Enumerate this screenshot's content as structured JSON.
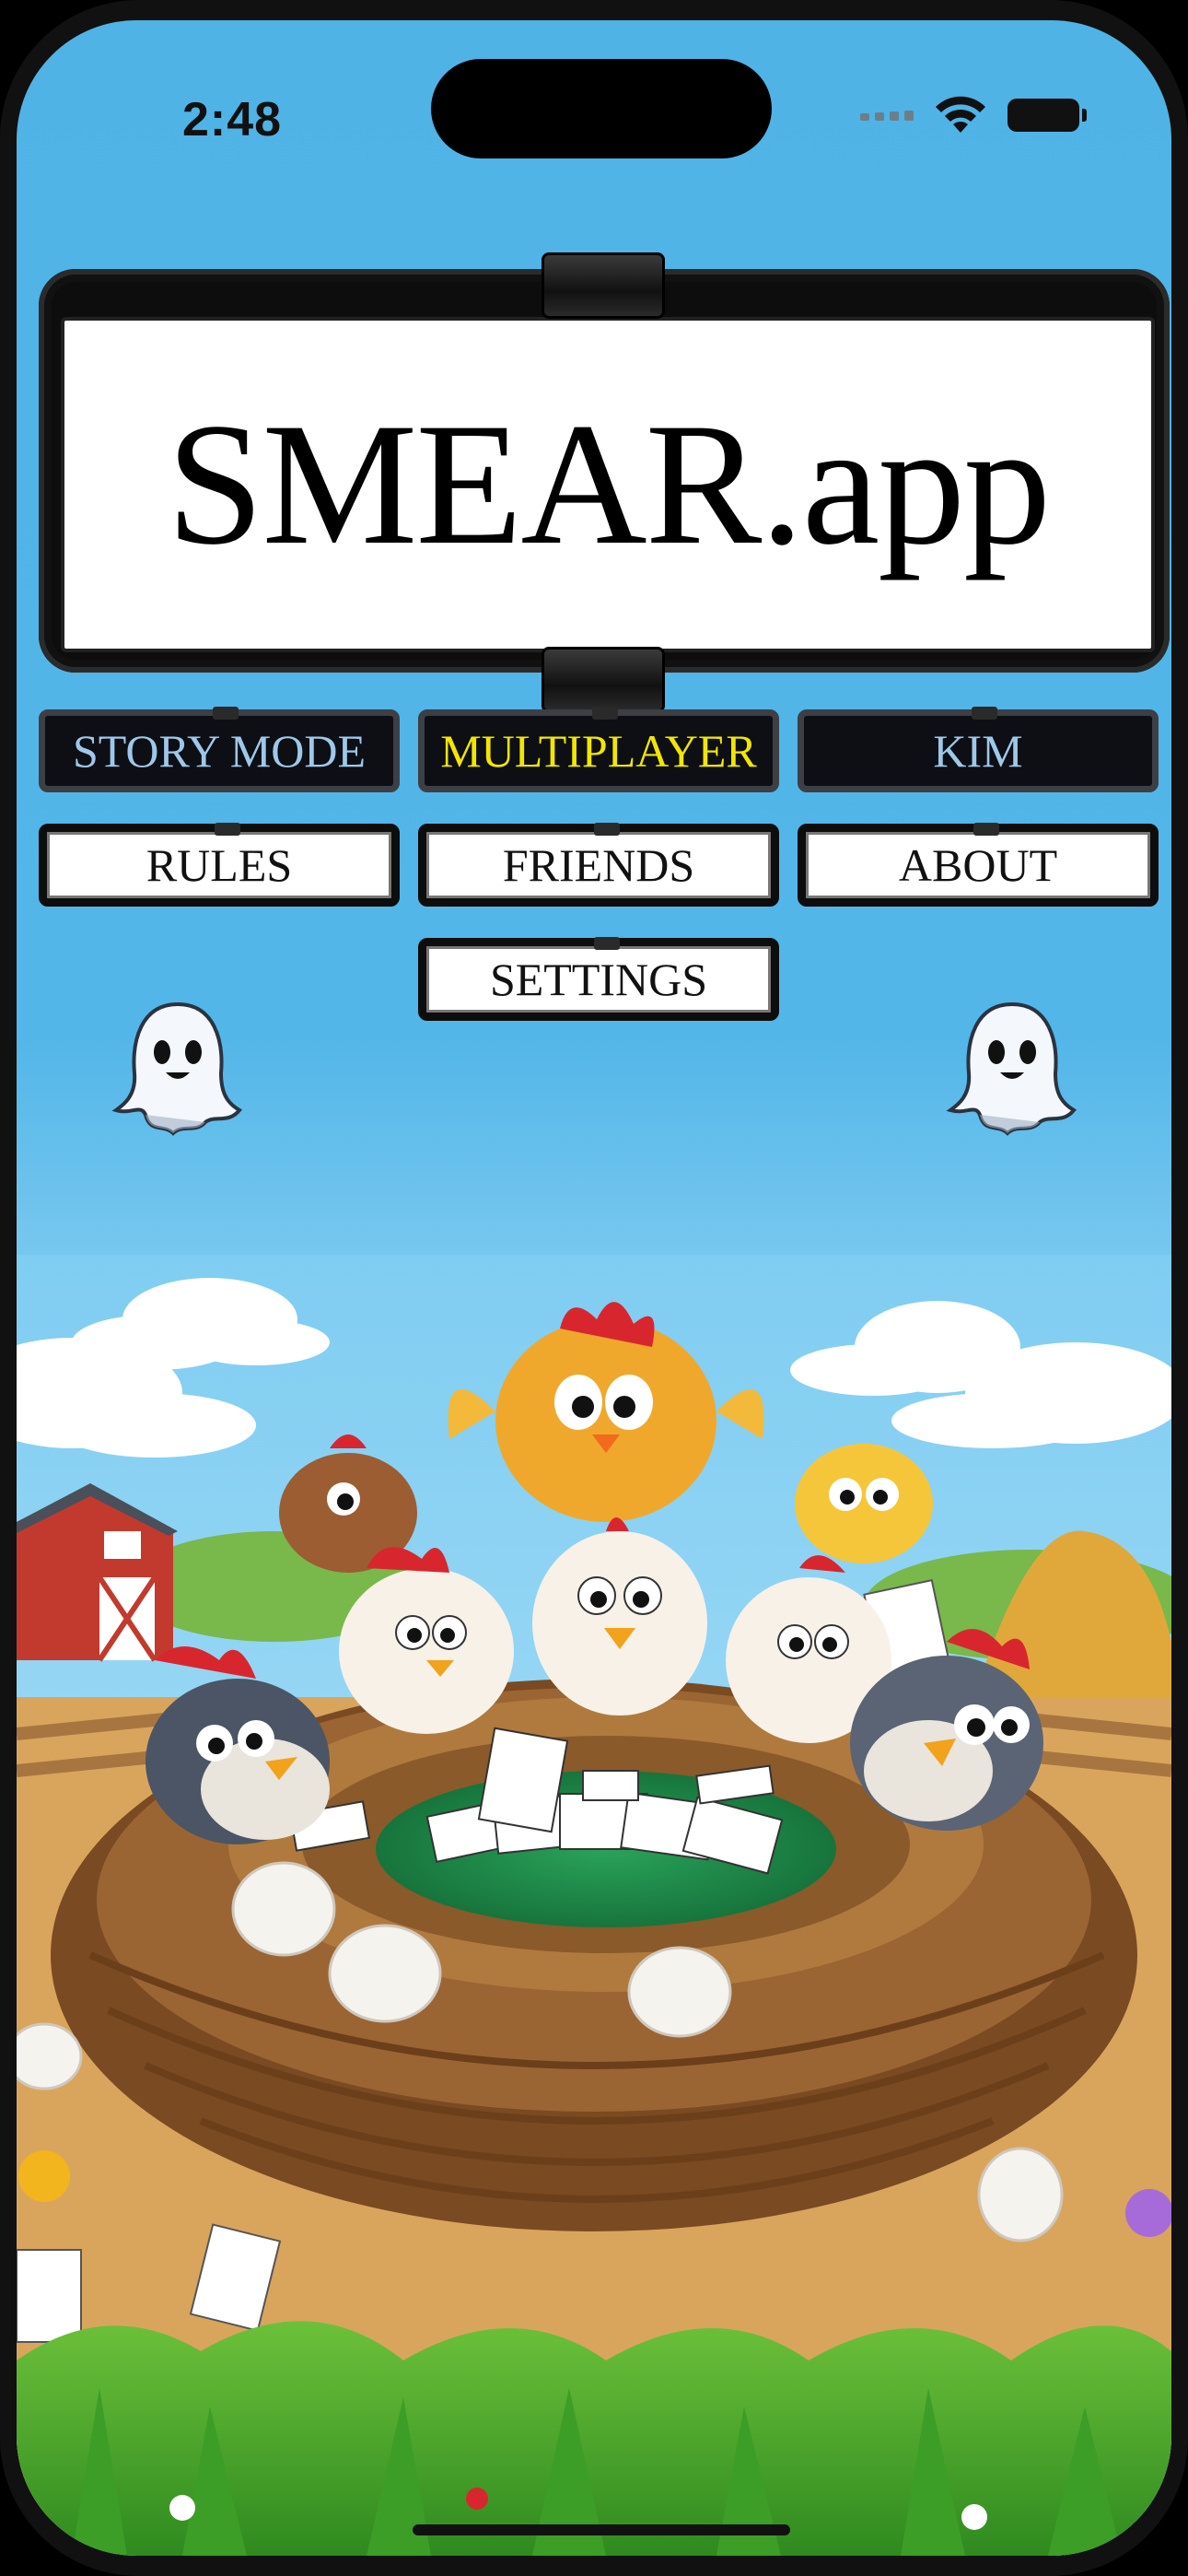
{
  "status_bar": {
    "time": "2:48"
  },
  "title": {
    "text": "SMEAR.app"
  },
  "menu": {
    "story_mode": "STORY MODE",
    "multiplayer": "MULTIPLAYER",
    "kim": "KIM",
    "rules": "RULES",
    "friends": "FRIENDS",
    "about": "ABOUT",
    "settings": "SETTINGS"
  },
  "colors": {
    "sky": "#4fb3e6",
    "dark_button_text": "#9ec8ea",
    "multiplayer_text": "#f2e600",
    "grass": "#3fa52a",
    "nest": "#8b5a2b",
    "table_felt": "#1f8a4c"
  },
  "icons": [
    "ghost-icon",
    "wifi-icon",
    "battery-icon",
    "cellular-icon"
  ]
}
